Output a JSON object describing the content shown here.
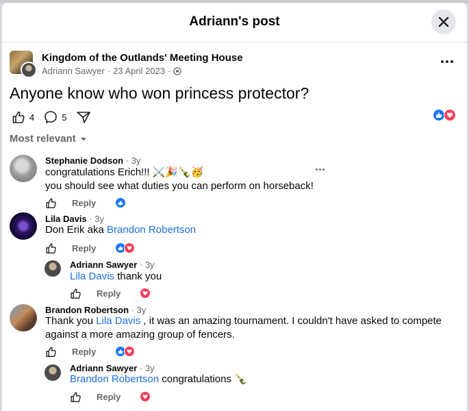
{
  "dialog": {
    "title": "Adriann's post"
  },
  "post": {
    "group_name": "Kingdom of the Outlands' Meeting House",
    "author": "Adriann Sawyer",
    "separator": "·",
    "date": "23 April 2023",
    "text": "Anyone know who won princess protector?",
    "like_count": "4",
    "comment_count": "5",
    "reactions": [
      "like-icon",
      "love-icon"
    ]
  },
  "sort": {
    "label": "Most relevant"
  },
  "comments": [
    {
      "name": "Stephanie Dodson",
      "age": "· 3y",
      "line1": "congratulations Erich!!! ⚔️🎉🍾🥳",
      "line2": "you should see what duties you can perform on horseback!",
      "reply_label": "Reply",
      "reactions": [
        "like-icon"
      ]
    },
    {
      "name": "Lila Davis",
      "age": "· 3y",
      "text_pre": "Don Erik aka ",
      "mention": "Brandon Robertson",
      "reply_label": "Reply",
      "reactions": [
        "like-icon",
        "love-icon"
      ]
    },
    {
      "name": "Adriann Sawyer",
      "age": "· 3y",
      "mention": "Lila Davis",
      "text_post": " thank you",
      "reply_label": "Reply",
      "reactions": [
        "love-icon"
      ]
    },
    {
      "name": "Brandon Robertson",
      "age": "· 3y",
      "text_pre": "Thank you ",
      "mention": "Lila Davis",
      "text_post": " , it was an amazing tournament. I couldn't have asked to compete",
      "line2": "against a more amazing group of fencers.",
      "reply_label": "Reply",
      "reactions": [
        "like-icon",
        "love-icon"
      ]
    },
    {
      "name": "Adriann Sawyer",
      "age": "· 3y",
      "mention": "Brandon Robertson",
      "text_post": " congratulations 🍾",
      "reply_label": "Reply",
      "reactions": [
        "love-icon"
      ]
    }
  ],
  "colors": {
    "link": "#1a6ed8",
    "like": "#1877f2",
    "love": "#f33e58",
    "muted": "#65676b"
  }
}
